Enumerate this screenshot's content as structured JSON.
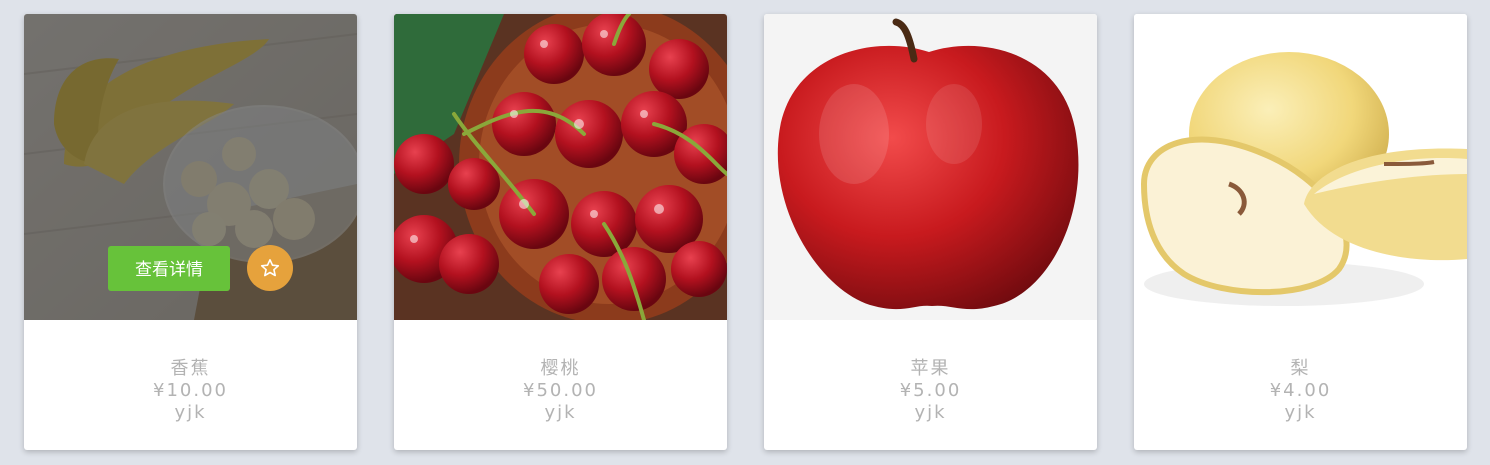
{
  "products": [
    {
      "name": "香蕉",
      "price": "¥10.00",
      "seller": "yjk",
      "image": "banana"
    },
    {
      "name": "樱桃",
      "price": "¥50.00",
      "seller": "yjk",
      "image": "cherry"
    },
    {
      "name": "苹果",
      "price": "¥5.00",
      "seller": "yjk",
      "image": "apple"
    },
    {
      "name": "梨",
      "price": "¥4.00",
      "seller": "yjk",
      "image": "pear"
    }
  ],
  "hover": {
    "detail_label": "查看详情",
    "favorite_icon": "star-icon"
  },
  "colors": {
    "detail_button": "#67c23a",
    "favorite_button": "#e6a23c",
    "text": "#b3b3b3",
    "background": "#dfe3ea"
  }
}
